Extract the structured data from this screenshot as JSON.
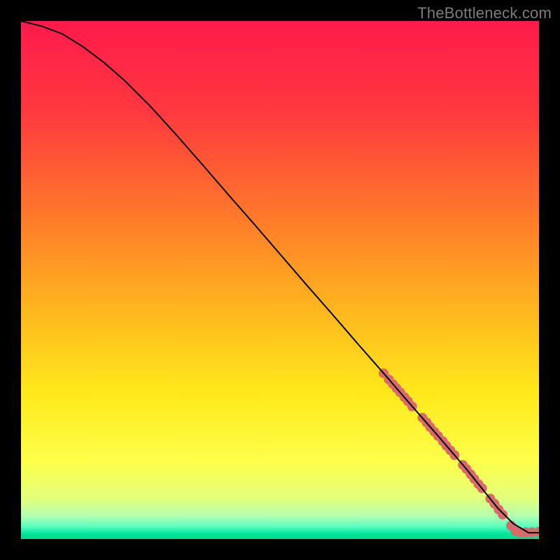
{
  "watermark": "TheBottleneck.com",
  "chart_data": {
    "type": "line",
    "title": "",
    "xlabel": "",
    "ylabel": "",
    "xlim": [
      0,
      100
    ],
    "ylim": [
      0,
      100
    ],
    "grid": false,
    "legend": false,
    "gradient_stops": [
      {
        "offset": 0.0,
        "color": "#ff1a4b"
      },
      {
        "offset": 0.18,
        "color": "#ff3a3f"
      },
      {
        "offset": 0.38,
        "color": "#ff7a2a"
      },
      {
        "offset": 0.55,
        "color": "#ffb41f"
      },
      {
        "offset": 0.72,
        "color": "#ffe91c"
      },
      {
        "offset": 0.85,
        "color": "#fdff4a"
      },
      {
        "offset": 0.92,
        "color": "#e4ff7a"
      },
      {
        "offset": 0.955,
        "color": "#b3ffb0"
      },
      {
        "offset": 0.975,
        "color": "#5dffc0"
      },
      {
        "offset": 0.99,
        "color": "#00e69b"
      },
      {
        "offset": 1.0,
        "color": "#00d98f"
      }
    ],
    "series": [
      {
        "name": "bottleneck-curve",
        "color": "#000000",
        "stroke_width": 2,
        "x": [
          0,
          4,
          8,
          12,
          16,
          20,
          25,
          30,
          35,
          40,
          45,
          50,
          55,
          60,
          65,
          70,
          75,
          80,
          83,
          86,
          88,
          90,
          92,
          95,
          98,
          100
        ],
        "y": [
          100,
          99,
          97.5,
          95,
          92,
          88.5,
          83.5,
          78,
          72.3,
          66.5,
          60.8,
          55,
          49.2,
          43.5,
          37.7,
          32,
          26.2,
          20.5,
          17,
          13.5,
          11,
          8.5,
          6,
          3,
          1.2,
          1.2
        ]
      }
    ],
    "scatter": [
      {
        "name": "curve-markers",
        "color": "#d96a6a",
        "radius": 7,
        "points": [
          {
            "x": 70.0,
            "y": 32.0
          },
          {
            "x": 71.0,
            "y": 30.8
          },
          {
            "x": 71.8,
            "y": 29.9
          },
          {
            "x": 72.5,
            "y": 29.1
          },
          {
            "x": 73.2,
            "y": 28.3
          },
          {
            "x": 74.0,
            "y": 27.4
          },
          {
            "x": 74.7,
            "y": 26.6
          },
          {
            "x": 75.5,
            "y": 25.6
          },
          {
            "x": 77.5,
            "y": 23.4
          },
          {
            "x": 78.3,
            "y": 22.5
          },
          {
            "x": 79.0,
            "y": 21.6
          },
          {
            "x": 79.8,
            "y": 20.7
          },
          {
            "x": 80.5,
            "y": 19.9
          },
          {
            "x": 81.4,
            "y": 18.9
          },
          {
            "x": 82.1,
            "y": 18.0
          },
          {
            "x": 82.9,
            "y": 17.1
          },
          {
            "x": 83.7,
            "y": 16.2
          },
          {
            "x": 85.3,
            "y": 14.3
          },
          {
            "x": 86.0,
            "y": 13.5
          },
          {
            "x": 86.8,
            "y": 12.5
          },
          {
            "x": 87.5,
            "y": 11.6
          },
          {
            "x": 88.3,
            "y": 10.6
          },
          {
            "x": 89.0,
            "y": 9.8
          },
          {
            "x": 90.6,
            "y": 7.8
          },
          {
            "x": 91.4,
            "y": 6.8
          },
          {
            "x": 92.2,
            "y": 5.7
          },
          {
            "x": 93.0,
            "y": 4.7
          },
          {
            "x": 94.6,
            "y": 2.6
          },
          {
            "x": 95.4,
            "y": 1.6
          },
          {
            "x": 96.3,
            "y": 1.3
          },
          {
            "x": 97.4,
            "y": 1.3
          },
          {
            "x": 98.6,
            "y": 1.3
          },
          {
            "x": 100.0,
            "y": 1.4
          }
        ]
      }
    ]
  }
}
